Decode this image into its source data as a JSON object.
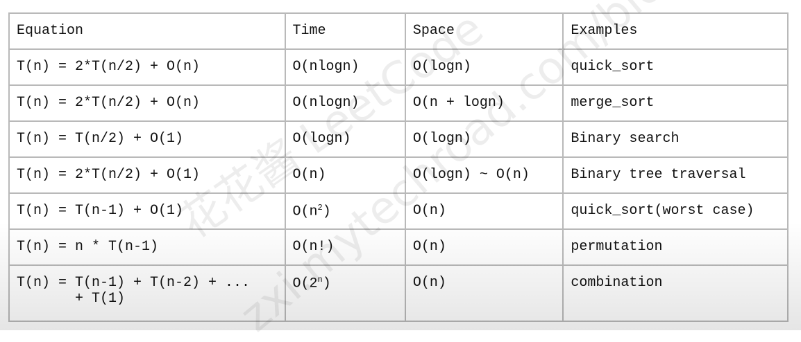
{
  "watermark": [
    "花花酱 LeetCode",
    "zxi.mytechroad.com/blog/"
  ],
  "headers": [
    "Equation",
    "Time",
    "Space",
    "Examples"
  ],
  "rows": [
    {
      "equation": "T(n) = 2*T(n/2) + O(n)",
      "time": "O(nlogn)",
      "space": "O(logn)",
      "example": "quick_sort"
    },
    {
      "equation": "T(n) = 2*T(n/2) + O(n)",
      "time": "O(nlogn)",
      "space": "O(n + logn)",
      "example": "merge_sort"
    },
    {
      "equation": "T(n) = T(n/2) + O(1)",
      "time": "O(logn)",
      "space": "O(logn)",
      "example": "Binary search"
    },
    {
      "equation": "T(n) = 2*T(n/2) + O(1)",
      "time": "O(n)",
      "space": "O(logn) ~ O(n)",
      "example": "Binary tree traversal"
    },
    {
      "equation": "T(n) = T(n-1) + O(1)",
      "time_base": "O(n",
      "time_sup": "2",
      "time_end": ")",
      "space": "O(n)",
      "example": "quick_sort(worst case)"
    },
    {
      "equation": "T(n) = n * T(n-1)",
      "time": "O(n!)",
      "space": "O(n)",
      "example": "permutation"
    },
    {
      "equation": "T(n) = T(n-1) + T(n-2) + ...\n       + T(1)",
      "time_base": "O(2",
      "time_sup": "n",
      "time_end": ")",
      "space": "O(n)",
      "example": "combination"
    }
  ]
}
